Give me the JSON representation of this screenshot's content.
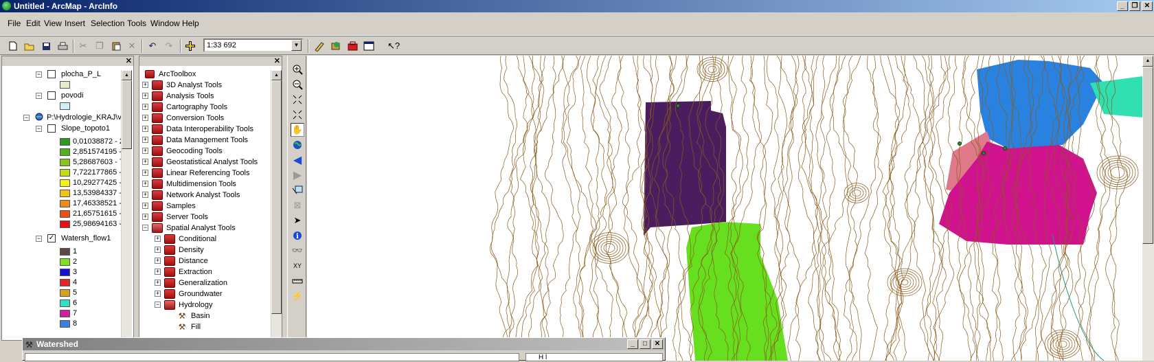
{
  "window": {
    "title": "Untitled - ArcMap - ArcInfo",
    "buttons": [
      "_",
      "❐",
      "✕"
    ]
  },
  "menu": [
    "File",
    "Edit",
    "View",
    "Insert",
    "Selection",
    "Tools",
    "Window",
    "Help"
  ],
  "toolbar": {
    "scale_value": "1:33 692"
  },
  "toc": {
    "items": [
      {
        "label": "plocha_P_L",
        "checked": false,
        "swatch": "#e3eecb"
      },
      {
        "label": "povodi",
        "checked": false,
        "swatch": "#cfeef5"
      },
      {
        "label": "P:\\Hydrologie_KRAJ\\v"
      },
      {
        "label": "Slope_topoto1",
        "checked": false
      },
      {
        "label": "Watersh_flow1",
        "checked": true
      }
    ],
    "slope_classes": [
      {
        "label": "0,01038872 - 2",
        "color": "#2e9a1c"
      },
      {
        "label": "2,851574195 -",
        "color": "#55b01e"
      },
      {
        "label": "5,28687603 - 7",
        "color": "#86c61c"
      },
      {
        "label": "7,722177865 -",
        "color": "#c3dc1a"
      },
      {
        "label": "10,29277425 -",
        "color": "#f2f21a"
      },
      {
        "label": "13,53984337 -",
        "color": "#f2c21a"
      },
      {
        "label": "17,46338521 -",
        "color": "#f08a1a"
      },
      {
        "label": "21,65751615 -",
        "color": "#ea5018"
      },
      {
        "label": "25,98694163 -",
        "color": "#e41414"
      }
    ],
    "watershed_classes": [
      {
        "label": "1",
        "color": "#5a4a44"
      },
      {
        "label": "2",
        "color": "#7ee024"
      },
      {
        "label": "3",
        "color": "#1010e0"
      },
      {
        "label": "4",
        "color": "#e02828"
      },
      {
        "label": "5",
        "color": "#d6a020"
      },
      {
        "label": "6",
        "color": "#30e0c0"
      },
      {
        "label": "7",
        "color": "#d020a0"
      },
      {
        "label": "8",
        "color": "#3a80e0"
      }
    ]
  },
  "toolbox": {
    "root": "ArcToolbox",
    "toolsets": [
      "3D Analyst Tools",
      "Analysis Tools",
      "Cartography Tools",
      "Conversion Tools",
      "Data Interoperability Tools",
      "Data Management Tools",
      "Geocoding Tools",
      "Geostatistical Analyst Tools",
      "Linear Referencing Tools",
      "Multidimension Tools",
      "Network Analyst Tools",
      "Samples",
      "Server Tools",
      "Spatial Analyst Tools"
    ],
    "spatial_children": [
      "Conditional",
      "Density",
      "Distance",
      "Extraction",
      "Generalization",
      "Groundwater",
      "Hydrology"
    ],
    "hydrology_tools": [
      "Basin",
      "Fill"
    ]
  },
  "watershed_dialog": {
    "title": "Watershed",
    "help_label": "H l"
  },
  "colors": {
    "contour": "#8b5a1a",
    "purple": "#4a1e5e",
    "green": "#66e01e",
    "blue": "#2a82e0",
    "magenta": "#d0128e",
    "pink": "#e07a8a",
    "teal": "#30e0b0"
  }
}
